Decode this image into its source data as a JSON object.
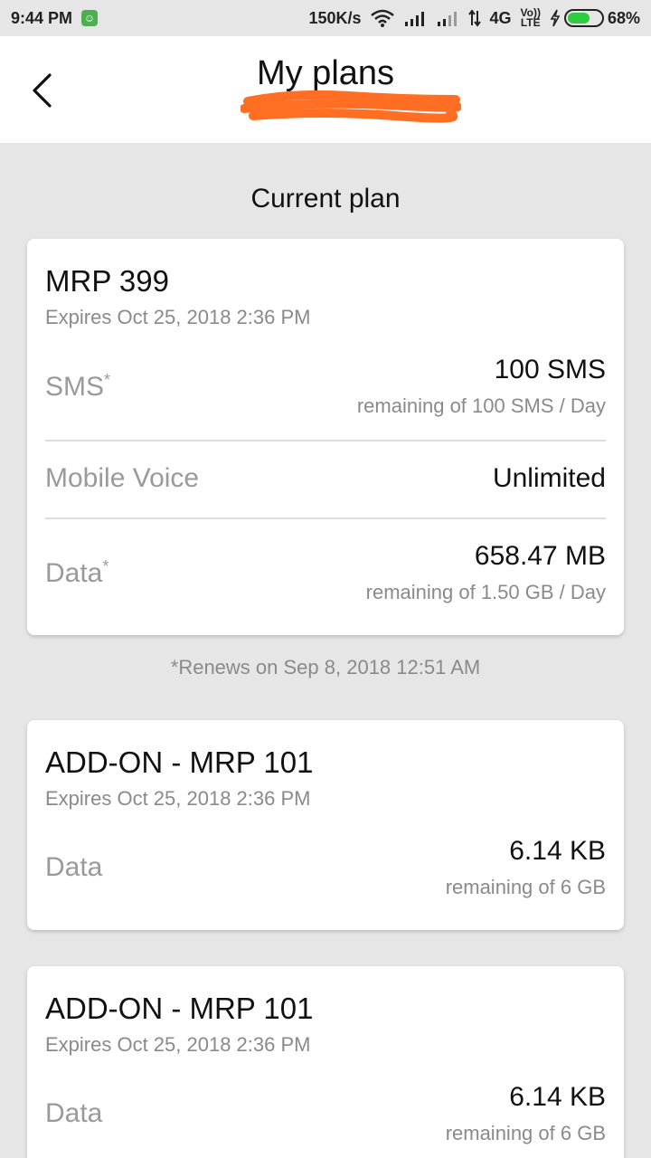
{
  "status_bar": {
    "time": "9:44 PM",
    "speed": "150K/s",
    "network": "4G",
    "volte_top": "Vo))",
    "volte_bottom": "LTE",
    "battery": "68%",
    "battery_level": 0.68
  },
  "header": {
    "title": "My plans"
  },
  "section_title": "Current plan",
  "current_plan": {
    "name": "MRP 399",
    "expiry": "Expires Oct 25, 2018 2:36 PM",
    "rows": [
      {
        "label": "SMS",
        "label_mark": "*",
        "value": "100 SMS",
        "sub": "remaining of 100 SMS / Day"
      },
      {
        "label": "Mobile Voice",
        "value": "Unlimited"
      },
      {
        "label": "Data",
        "label_mark": "*",
        "value": "658.47 MB",
        "sub": "remaining of 1.50 GB / Day"
      }
    ]
  },
  "renew_note": "*Renews on Sep 8, 2018 12:51 AM",
  "addons": [
    {
      "name": "ADD-ON - MRP 101",
      "expiry": "Expires Oct 25, 2018 2:36 PM",
      "label": "Data",
      "value": "6.14 KB",
      "sub": "remaining of 6 GB"
    },
    {
      "name": "ADD-ON - MRP 101",
      "expiry": "Expires Oct 25, 2018 2:36 PM",
      "label": "Data",
      "value": "6.14 KB",
      "sub": "remaining of 6 GB"
    }
  ],
  "colors": {
    "accent_redaction": "#ff6e22",
    "background": "#e6e6e6",
    "card": "#ffffff"
  }
}
